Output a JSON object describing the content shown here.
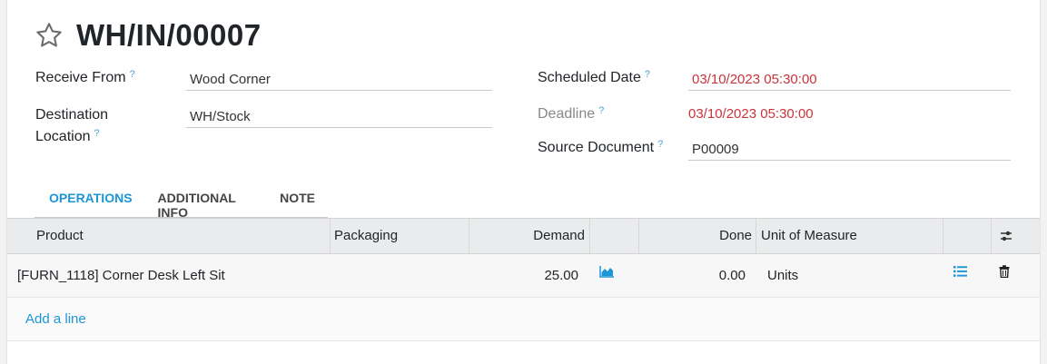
{
  "record": {
    "title": "WH/IN/00007"
  },
  "form": {
    "receive_from": {
      "label": "Receive From",
      "help": "?",
      "value": "Wood Corner"
    },
    "destination_location": {
      "label_line1": "Destination",
      "label_line2": "Location",
      "help": "?",
      "value": "WH/Stock"
    },
    "scheduled_date": {
      "label": "Scheduled Date",
      "help": "?",
      "value": "03/10/2023 05:30:00"
    },
    "deadline": {
      "label": "Deadline",
      "help": "?",
      "value": "03/10/2023 05:30:00"
    },
    "source_document": {
      "label": "Source Document",
      "help": "?",
      "value": "P00009"
    }
  },
  "tabs": [
    {
      "label": "OPERATIONS",
      "active": true
    },
    {
      "label": "ADDITIONAL INFO",
      "active": false
    },
    {
      "label": "NOTE",
      "active": false
    }
  ],
  "table": {
    "columns": {
      "product": "Product",
      "packaging": "Packaging",
      "demand": "Demand",
      "done": "Done",
      "uom": "Unit of Measure"
    },
    "rows": [
      {
        "product": "[FURN_1118] Corner Desk Left Sit",
        "packaging": "",
        "demand": "25.00",
        "done": "0.00",
        "uom": "Units"
      }
    ],
    "add_line": "Add a line"
  },
  "icons": {
    "favorite": "star-outline-icon",
    "forecast": "area-chart-icon",
    "details": "list-icon",
    "delete": "trash-icon",
    "optional_columns": "sliders-icon"
  },
  "colors": {
    "accent": "#1d96d8",
    "alert": "#c9343b",
    "help": "#4ca3d5"
  }
}
